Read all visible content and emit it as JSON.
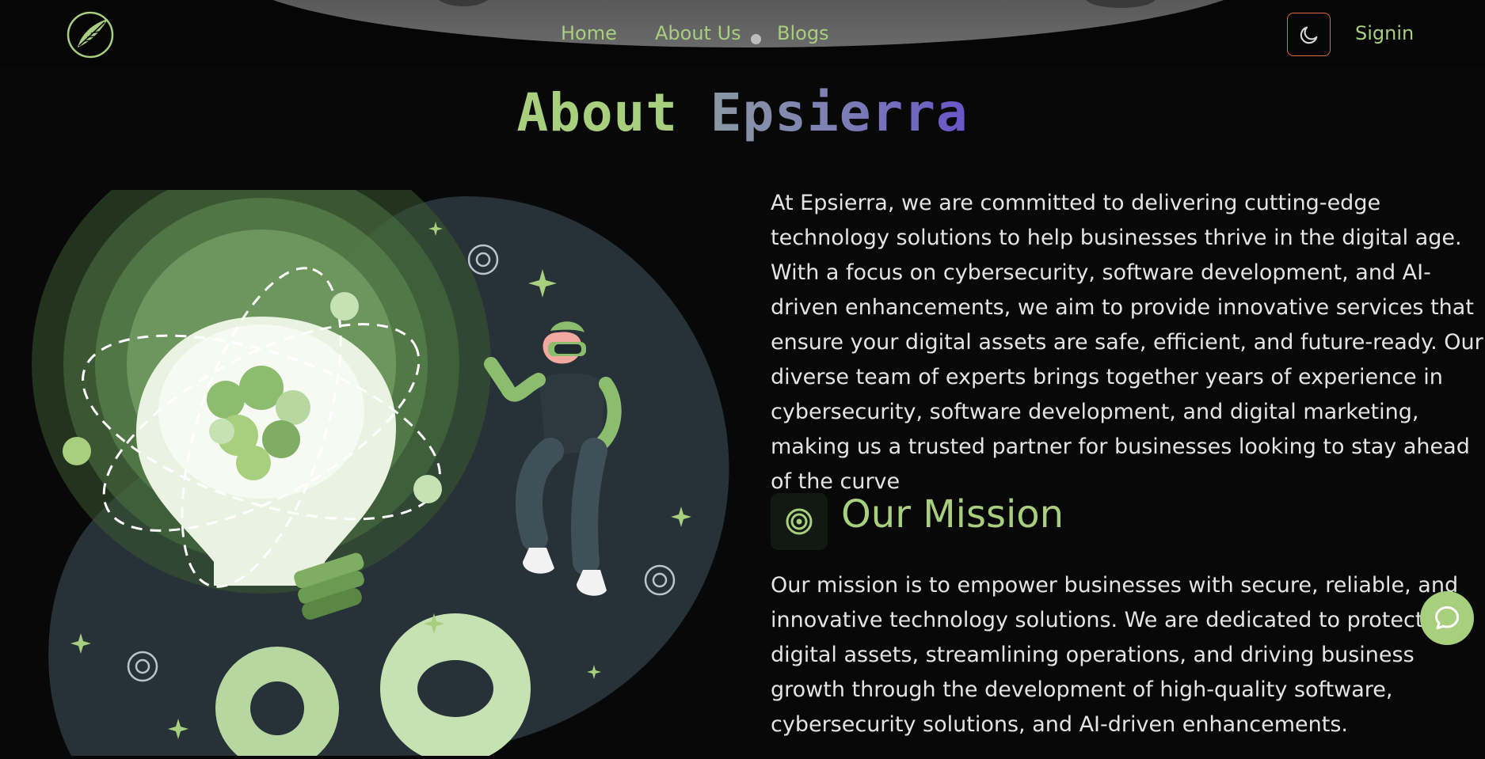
{
  "nav": {
    "links": [
      "Home",
      "About Us",
      "Blogs"
    ],
    "signin": "Signin",
    "logo": "leaf-logo",
    "theme_icon": "moon-icon"
  },
  "title": {
    "part1": "About ",
    "part2": "Epsierra"
  },
  "intro": "At Epsierra, we are committed to delivering cutting-edge technology solutions to help businesses thrive in the digital age. With a focus on cybersecurity, software development, and AI-driven enhancements, we aim to provide innovative services that ensure your digital assets are safe, efficient, and future-ready. Our diverse team of experts brings together years of experience in cybersecurity, software development, and digital marketing, making us a trusted partner for businesses looking to stay ahead of the curve",
  "mission": {
    "icon": "target-icon",
    "heading": "Our Mission",
    "text": "Our mission is to empower businesses with secure, reliable, and innovative technology solutions. We are dedicated to protecting digital assets, streamlining operations, and driving business growth through the development of high-quality software, cybersecurity solutions, and AI-driven enhancements."
  },
  "chat": {
    "icon": "chat-bubble-icon"
  },
  "colors": {
    "accent": "#a7cf7e",
    "background": "#080808",
    "toggle_border": "#e06a3a",
    "title_gradient": [
      "#8a98a3",
      "#6a55c8"
    ]
  }
}
